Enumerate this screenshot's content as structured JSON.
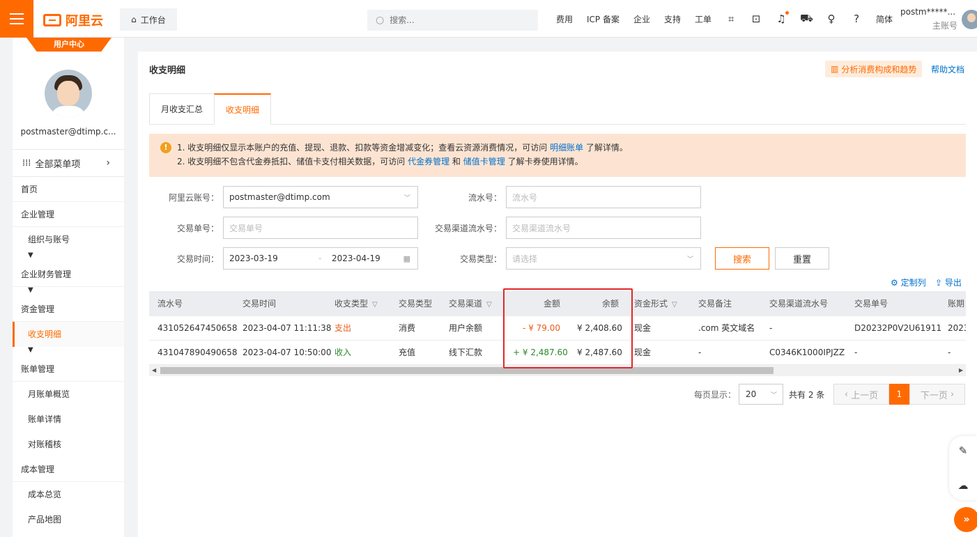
{
  "header": {
    "logo_text": "阿里云",
    "workbench_label": "工作台",
    "search_placeholder": "搜索...",
    "nav": [
      "费用",
      "ICP 备案",
      "企业",
      "支持",
      "工单"
    ],
    "lang_label": "简体",
    "account": "postm*****...",
    "role": "主账号",
    "accent_color": "#ff6a00"
  },
  "sidebar": {
    "center_label": "用户中心",
    "email": "postmaster@dtimp.c...",
    "all_menu_label": "全部菜单项",
    "items": [
      {
        "label": "首页",
        "type": "top"
      },
      {
        "label": "企业管理",
        "type": "top"
      },
      {
        "label": "组织与账号",
        "type": "sub"
      },
      {
        "label": "企业财务管理",
        "type": "top"
      },
      {
        "label": "资金管理",
        "type": "top"
      },
      {
        "label": "收支明细",
        "type": "active"
      },
      {
        "label": "账单管理",
        "type": "top"
      },
      {
        "label": "月账单概览",
        "type": "sub"
      },
      {
        "label": "账单详情",
        "type": "sub"
      },
      {
        "label": "对账稽核",
        "type": "sub"
      },
      {
        "label": "成本管理",
        "type": "top"
      },
      {
        "label": "成本总览",
        "type": "sub"
      },
      {
        "label": "产品地图",
        "type": "sub"
      }
    ]
  },
  "main": {
    "title": "收支明细",
    "analyze_label": "分析消费构成和趋势",
    "help_label": "帮助文档",
    "tabs": [
      "月收支汇总",
      "收支明细"
    ],
    "notice": {
      "line1_prefix": "1. 收支明细仅显示本账户的充值、提现、退款、扣款等资金增减变化；查看云资源消费情况，可访问 ",
      "line1_link": "明细账单",
      "line1_suffix": " 了解详情。",
      "line2_prefix": "2. 收支明细不包含代金券抵扣、储值卡支付相关数据，可访问 ",
      "line2_link1": "代金券管理",
      "line2_mid": " 和 ",
      "line2_link2": "储值卡管理",
      "line2_suffix": " 了解卡券使用详情。"
    },
    "filters": {
      "account_label": "阿里云账号：",
      "account_value": "postmaster@dtimp.com",
      "serial_label": "流水号：",
      "serial_placeholder": "流水号",
      "order_label": "交易单号：",
      "order_placeholder": "交易单号",
      "channel_serial_label": "交易渠道流水号：",
      "channel_serial_placeholder": "交易渠道流水号",
      "time_label": "交易时间：",
      "time_start": "2023-03-19",
      "time_sep": "-",
      "time_end": "2023-04-19",
      "type_label": "交易类型：",
      "type_placeholder": "请选择",
      "search_label": "搜索",
      "reset_label": "重置"
    },
    "tools": {
      "customize_label": "定制列",
      "export_label": "导出"
    },
    "table": {
      "columns": [
        "流水号",
        "交易时间",
        "收支类型",
        "交易类型",
        "交易渠道",
        "金额",
        "余额",
        "资金形式",
        "交易备注",
        "交易渠道流水号",
        "交易单号",
        "账期"
      ],
      "rows": [
        {
          "serial": "431052647450658",
          "time": "2023-04-07 11:11:38",
          "flow": "支出",
          "type": "消费",
          "channel": "用户余额",
          "amount": "- ¥ 79.00",
          "balance": "¥ 2,408.60",
          "fund": "现金",
          "remark": ".com 英文域名",
          "channel_serial": "-",
          "order": "D20232P0V2U61911",
          "period": "2023"
        },
        {
          "serial": "431047890490658",
          "time": "2023-04-07 10:50:00",
          "flow": "收入",
          "type": "充值",
          "channel": "线下汇款",
          "amount": "+ ¥ 2,487.60",
          "balance": "¥ 2,487.60",
          "fund": "现金",
          "remark": "-",
          "channel_serial": "C0346K1000IPJZZ",
          "order": "-",
          "period": "-"
        }
      ]
    },
    "pager": {
      "page_size_label": "每页显示：",
      "page_size": "20",
      "total": "共有 2 条",
      "prev": "上一页",
      "current": "1",
      "next": "下一页"
    }
  }
}
